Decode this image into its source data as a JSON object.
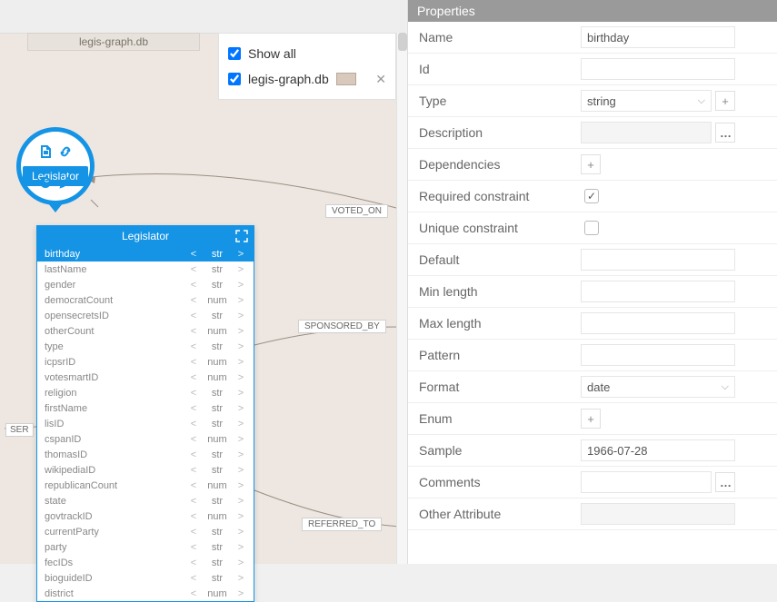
{
  "dbTab": "legis-graph.db",
  "legend": {
    "showAll": "Show all",
    "dbName": "legis-graph.db"
  },
  "node": {
    "label": "Legislator"
  },
  "edges": {
    "votedOn": "VOTED_ON",
    "sponsoredBy": "SPONSORED_BY",
    "referredTo": "REFERRED_TO",
    "ser": "SER"
  },
  "tableTitle": "Legislator",
  "attrs": [
    {
      "name": "birthday",
      "type": "str",
      "selected": true
    },
    {
      "name": "lastName",
      "type": "str"
    },
    {
      "name": "gender",
      "type": "str"
    },
    {
      "name": "democratCount",
      "type": "num"
    },
    {
      "name": "opensecretsID",
      "type": "str"
    },
    {
      "name": "otherCount",
      "type": "num"
    },
    {
      "name": "type",
      "type": "str"
    },
    {
      "name": "icpsrID",
      "type": "num"
    },
    {
      "name": "votesmartID",
      "type": "num"
    },
    {
      "name": "religion",
      "type": "str"
    },
    {
      "name": "firstName",
      "type": "str"
    },
    {
      "name": "lisID",
      "type": "str"
    },
    {
      "name": "cspanID",
      "type": "num"
    },
    {
      "name": "thomasID",
      "type": "str"
    },
    {
      "name": "wikipediaID",
      "type": "str"
    },
    {
      "name": "republicanCount",
      "type": "num"
    },
    {
      "name": "state",
      "type": "str"
    },
    {
      "name": "govtrackID",
      "type": "num"
    },
    {
      "name": "currentParty",
      "type": "str"
    },
    {
      "name": "party",
      "type": "str"
    },
    {
      "name": "fecIDs",
      "type": "str"
    },
    {
      "name": "bioguideID",
      "type": "str"
    },
    {
      "name": "district",
      "type": "num"
    }
  ],
  "props": {
    "header": "Properties",
    "labels": {
      "name": "Name",
      "id": "Id",
      "type": "Type",
      "description": "Description",
      "dependencies": "Dependencies",
      "required": "Required constraint",
      "unique": "Unique constraint",
      "default": "Default",
      "minLength": "Min length",
      "maxLength": "Max length",
      "pattern": "Pattern",
      "format": "Format",
      "enum": "Enum",
      "sample": "Sample",
      "comments": "Comments",
      "other": "Other Attribute"
    },
    "values": {
      "name": "birthday",
      "id": "",
      "type": "string",
      "description": "",
      "required": true,
      "unique": false,
      "default": "",
      "minLength": "",
      "maxLength": "",
      "pattern": "",
      "format": "date",
      "sample": "1966-07-28",
      "comments": ""
    }
  }
}
